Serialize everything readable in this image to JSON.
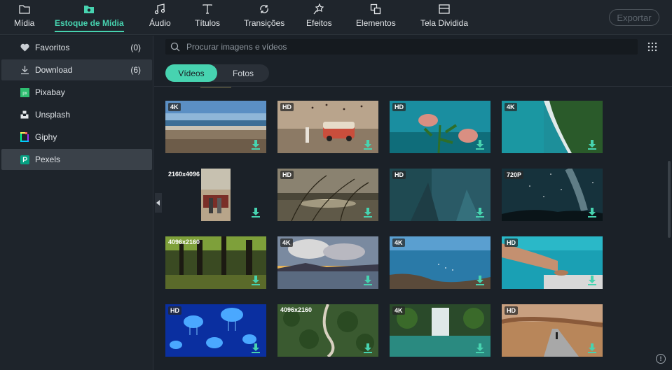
{
  "tabs": [
    {
      "label": "Mídia",
      "icon": "folder-icon"
    },
    {
      "label": "Estoque de Mídia",
      "icon": "stock-media-icon",
      "active": true
    },
    {
      "label": "Áudio",
      "icon": "music-note-icon"
    },
    {
      "label": "Títulos",
      "icon": "text-icon"
    },
    {
      "label": "Transições",
      "icon": "transitions-icon"
    },
    {
      "label": "Efeitos",
      "icon": "effects-icon"
    },
    {
      "label": "Elementos",
      "icon": "elements-icon"
    },
    {
      "label": "Tela Dividida",
      "icon": "split-screen-icon"
    }
  ],
  "export_label": "Exportar",
  "sidebar": {
    "items": [
      {
        "label": "Favoritos",
        "count": "(0)",
        "icon": "heart-icon"
      },
      {
        "label": "Download",
        "count": "(6)",
        "icon": "download-icon"
      },
      {
        "label": "Pixabay",
        "count": "",
        "icon": "pixabay-icon"
      },
      {
        "label": "Unsplash",
        "count": "",
        "icon": "unsplash-icon"
      },
      {
        "label": "Giphy",
        "count": "",
        "icon": "giphy-icon"
      },
      {
        "label": "Pexels",
        "count": "",
        "icon": "pexels-icon"
      }
    ]
  },
  "search": {
    "placeholder": "Procurar imagens e vídeos"
  },
  "media_tabs": {
    "videos": "Vídeos",
    "photos": "Fotos"
  },
  "accent_color": "#47d3b0",
  "thumbnails": [
    {
      "badge": "4K",
      "scene": "beach"
    },
    {
      "badge": "HD",
      "scene": "van"
    },
    {
      "badge": "HD",
      "scene": "flower"
    },
    {
      "badge": "4K",
      "scene": "aerial-coast"
    },
    {
      "badge": "2160x4096",
      "scene": "portrait-car"
    },
    {
      "badge": "HD",
      "scene": "grass-sunset"
    },
    {
      "badge": "HD",
      "scene": "underwater"
    },
    {
      "badge": "720P",
      "scene": "milky-way"
    },
    {
      "badge": "4096x2160",
      "scene": "forest"
    },
    {
      "badge": "4K",
      "scene": "clouds-sunset"
    },
    {
      "badge": "4K",
      "scene": "sea-rocks"
    },
    {
      "badge": "HD",
      "scene": "pool-legs"
    },
    {
      "badge": "HD",
      "scene": "jellyfish"
    },
    {
      "badge": "4096x2160",
      "scene": "forest-road"
    },
    {
      "badge": "4K",
      "scene": "waterfall"
    },
    {
      "badge": "HD",
      "scene": "desert-road"
    }
  ],
  "info_label": "!"
}
